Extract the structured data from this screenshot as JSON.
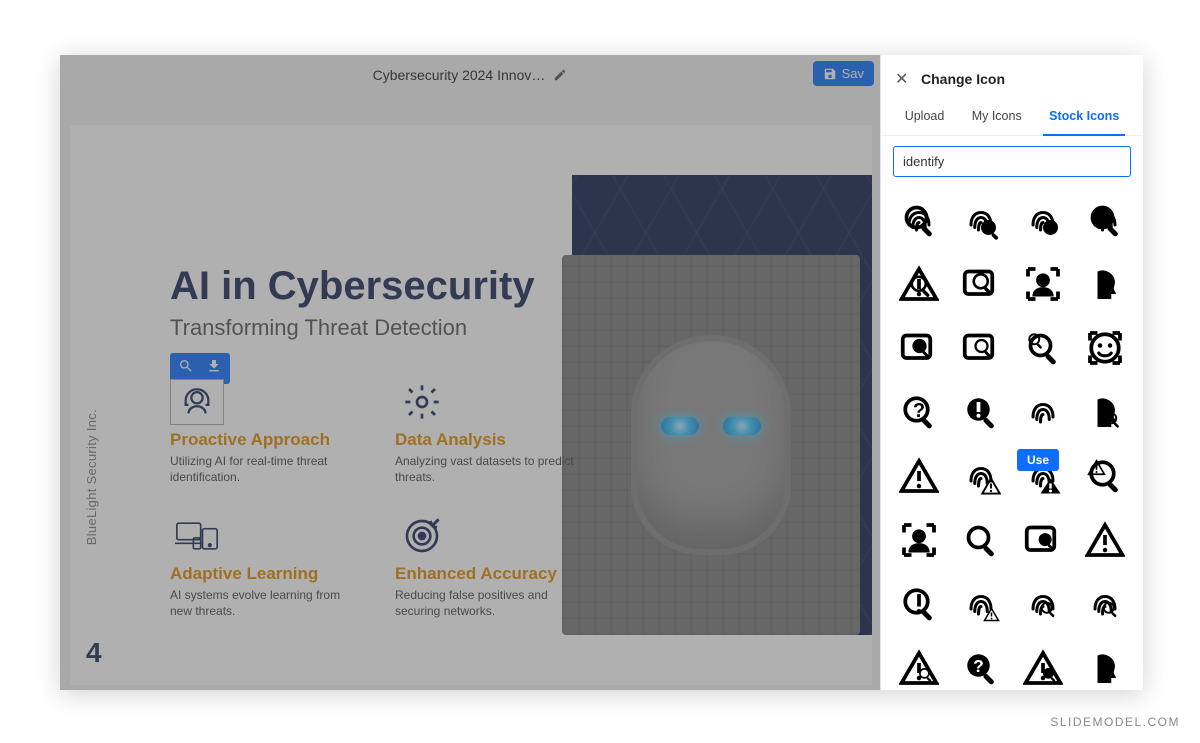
{
  "topbar": {
    "doc_title": "Cybersecurity 2024 Innov…",
    "save_label": "Sav"
  },
  "slide": {
    "company": "BlueLight Security Inc.",
    "page_number": "4",
    "headline": "AI in Cybersecurity",
    "subheadline": "Transforming Threat Detection",
    "features": [
      {
        "title": "Proactive Approach",
        "desc": "Utilizing AI for real-time threat identification.",
        "icon": "headset-icon"
      },
      {
        "title": "Data Analysis",
        "desc": "Analyzing vast datasets to predict threats.",
        "icon": "gear-icon"
      },
      {
        "title": "Adaptive Learning",
        "desc": "AI systems evolve learning from new threats.",
        "icon": "devices-icon"
      },
      {
        "title": "Enhanced Accuracy",
        "desc": "Reducing false positives and securing networks.",
        "icon": "target-icon"
      }
    ]
  },
  "panel": {
    "title": "Change Icon",
    "tabs": {
      "upload": "Upload",
      "myicons": "My Icons",
      "stock": "Stock Icons",
      "active": "stock"
    },
    "search_value": "identify",
    "use_label": "Use",
    "icons": [
      "fingerprint-search-icon",
      "fingerprint-magnify-solid-icon",
      "fingerprint-search-dark-icon",
      "fingerprint-magnify-alt-icon",
      "alert-search-icon",
      "doc-search-icon",
      "focus-person-icon",
      "head-profile-icon",
      "card-search-icon",
      "data-search-icon",
      "loupe-search-icon",
      "face-scan-icon",
      "question-search-icon",
      "alert-magnify-icon",
      "fingerprint-thin-icon",
      "head-search-icon",
      "warning-triangle-icon",
      "fingerprint-warn-icon",
      "fingerprint-alert-selected-icon",
      "warning-loupe-icon",
      "scan-person-icon",
      "loupe-outline-icon",
      "card-magnify-icon",
      "triangle-alert-icon",
      "loupe-alert-outline-icon",
      "fingerprint-warn2-icon",
      "fingerprint-loupe-icon",
      "fingerprint-scan-icon",
      "triangle-search-icon",
      "question-loupe-icon",
      "warn-magnify-icon",
      "head-outline-icon"
    ],
    "selected_index": 18
  },
  "watermark": "SLIDEMODEL.COM"
}
